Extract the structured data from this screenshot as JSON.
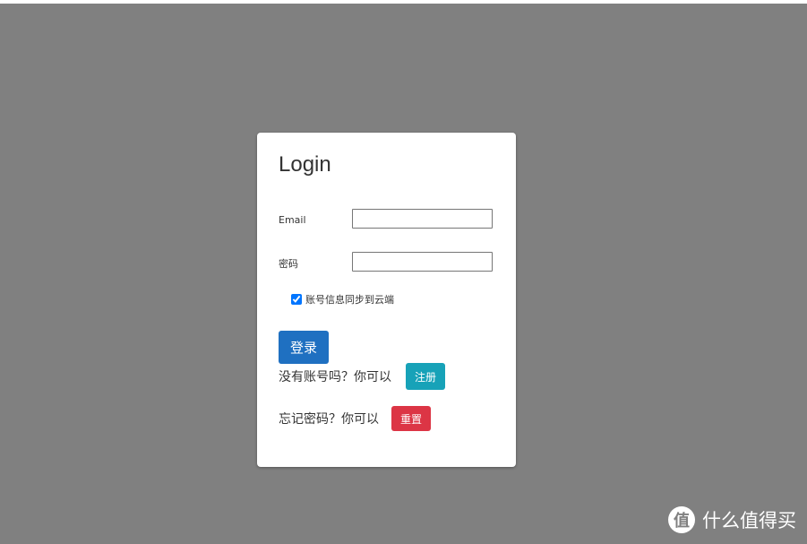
{
  "login_card": {
    "title": "Login",
    "email_label": "Email",
    "email_value": "",
    "password_label": "密码",
    "password_value": "",
    "sync_label": "账号信息同步到云端",
    "sync_checked": true,
    "login_button": "登录",
    "no_account_text": "没有账号吗？你可以",
    "register_button": "注册",
    "forgot_text": "忘记密码？你可以",
    "reset_button": "重置"
  },
  "watermark": {
    "icon_glyph": "值",
    "text": "什么值得买"
  },
  "colors": {
    "backdrop": "#808080",
    "login_button": "#1f70c1",
    "register_button": "#17a2b8",
    "reset_button": "#dc3545"
  }
}
